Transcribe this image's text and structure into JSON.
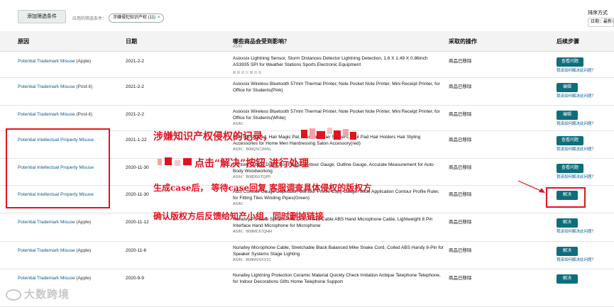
{
  "toolbar": {
    "add_filter_label": "添加筛选条件",
    "applied_filters_label": "应用的筛选条件：",
    "filter_chip_label": "涉嫌侵犯知识产权 (11)",
    "filter_chip_remove": "×",
    "sort_label": "排序方式",
    "sort_value": "日期：最新>"
  },
  "table": {
    "headers": {
      "reason": "原因",
      "date": "日期",
      "product": "哪些商品会受到影响？",
      "product_sub": "ASIN",
      "action": "采取的操作",
      "next": "后续步骤"
    },
    "rows": [
      {
        "reason": "Potential Trademark Misuse",
        "reason_paren": "(Apple)",
        "date": "2021-2-2",
        "product": "Asixxsix Lightning Sensor, Storm Distances Detector Lightning Detection, 1.6 X 1.49 X 0.86inch AS3935 SPI for Weather Stations Sports Electronic Equipment",
        "asin": "",
        "action": "商品已移除",
        "button": "查看问题",
        "help": "我该如何解决此问题？"
      },
      {
        "reason": "Potential Trademark Misuse",
        "reason_paren": "(Post-it)",
        "date": "2021-2-2",
        "product": "Asixxsix Wireless Bluetooth 57mm Thermal Printer, Note Pocket Note Printer, Mini Receipt Printer, for Office for Students(Pink)",
        "asin": "",
        "action": "商品已移除",
        "button": "编辑",
        "help": "我该如何解决此问题？"
      },
      {
        "reason": "Potential Trademark Misuse",
        "reason_paren": "(Post-it)",
        "date": "2021-2-2",
        "product": "Asixxsix Wireless Bluetooth 57mm Thermal Printer, Note Pocket Note Printer, Mini Receipt Printer, for Office for Students(White)",
        "asin": "ASIN：",
        "action": "商品已移除",
        "button": "编辑",
        "help": "我该如何解决此问题？"
      },
      {
        "reason": "Potential Intellectual Property Misuse",
        "reason_paren": "",
        "date": "2021-1-22",
        "product": "Hair Sticker Pad, Hair Magic Pat, Hair Pad, Hair Stickers, Hair Pad Hair Holders Hair Styling Accessories for Home Men Hairdressing Salon Accessory(red)",
        "asin": "ASIN：B08QSC2MSL",
        "action": "商品已移除",
        "button": "查看问题",
        "help": "我该如何解决此问题？"
      },
      {
        "reason": "Potential Intellectual Property Misuse",
        "reason_paren": "",
        "date": "2020-11-30",
        "product": "Contour Gauge Duplicator Plastic Contour Gauge, Outline Gauge, Accurate Measurement for Auto Body Woodworking",
        "asin": "ASIN：B08D6XTQPF",
        "action": "商品已移除",
        "button": "查看问题",
        "help": "我该如何解决此问题？"
      },
      {
        "reason": "Potential Intellectual Property Misuse",
        "reason_paren": "",
        "date": "2020-11-30",
        "product": "ABS Contour Gauge Duplicator, Contour Profile Copy Gauge, Wide Application Contour Profile Ruler, for Fitting Tiles Winding Pipes(Green)",
        "asin": "ASIN：",
        "action": "商品已移除",
        "button": "解决",
        "help": ""
      },
      {
        "reason": "Potential Trademark Misuse",
        "reason_paren": "(Apple)",
        "date": "2020-11-12",
        "product": "Nunafey Portable Speaker Mic Cord, Thick Cable ABS Hand Microphone Cable, Lightweight 8 Pin Interface Hand Microphone for Microphone",
        "asin": "ASIN：B08MC67QHH",
        "action": "商品已移除",
        "button": "解决",
        "help": "我该如何解决此问题？"
      },
      {
        "reason": "Potential Trademark Misuse",
        "reason_paren": "(Apple)",
        "date": "2020-11-6",
        "product": "Nunafey Microphone Cable, Stretchable Black Balanced Mike Snake Cord, Coiled ABS Handy 8-Pin for Speaker Systems Stage Lighting",
        "asin": "ASIN：B08MVSXV1C",
        "action": "商品已移除",
        "button": "解决",
        "help": "我该如何解决此问题？"
      },
      {
        "reason": "Potential Trademark Misuse",
        "reason_paren": "(Apple)",
        "date": "2020-9-9",
        "product": "Nunafey Lightning Protection Ceramic Material Quickly Check Imitation Antique Telephone Telephone, for Indoor Decorations Gifts Home Telephone Support",
        "asin": "",
        "action": "商品已移除",
        "button": "解决",
        "help": ""
      }
    ]
  },
  "annotations": {
    "note1": "涉嫌知识产权侵权的记录，",
    "note2": "点击“解决”按钮 进行处理",
    "note3": "生成case后， 等待case回复 客服调查具体侵权的版权方",
    "note4": "确认版权方后反馈给知产小组，同时删掉链接",
    "color": "#e0141e"
  },
  "watermark": "大数跨境",
  "colors": {
    "button": "#0d6e7c",
    "link": "#0a5a8e",
    "header_bg": "#f3f3f3"
  }
}
